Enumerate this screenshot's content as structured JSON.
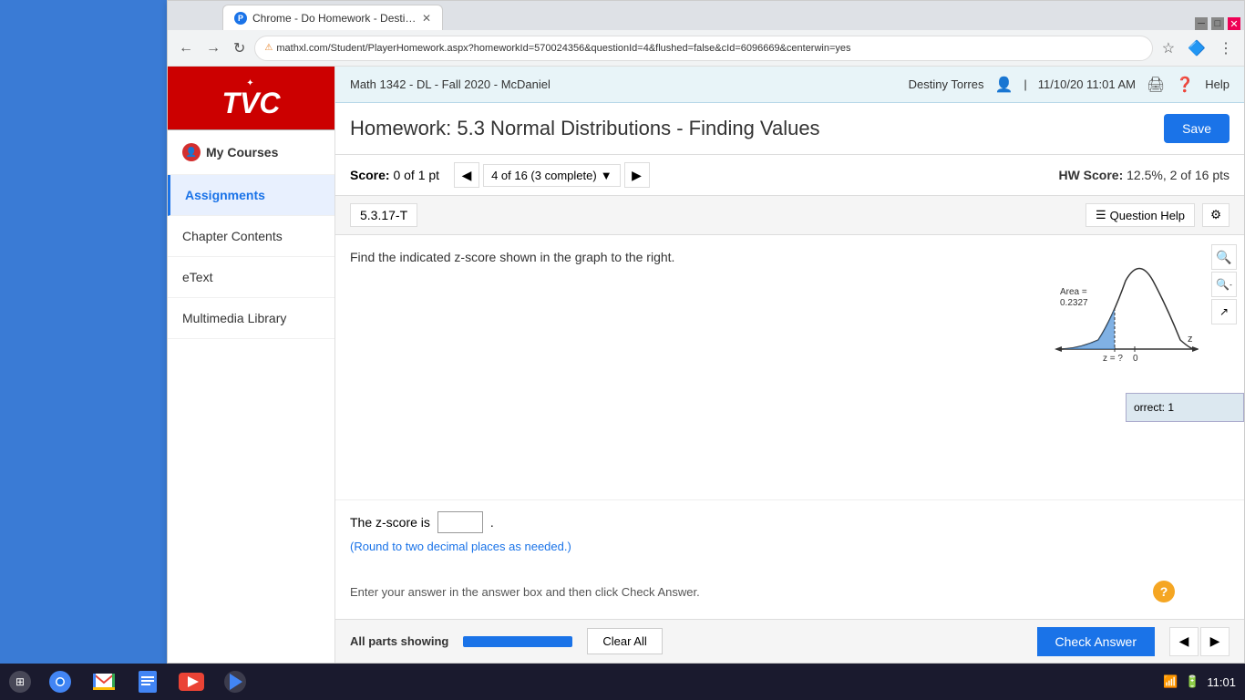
{
  "browser": {
    "title": "Chrome - Do Homework - Destiny Torres",
    "tab_label": "Chrome - Do Homework - Destiny Torres",
    "tab_favicon": "P",
    "url": "mathxl.com/Student/PlayerHomework.aspx?homeworkId=570024356&questionId=4&flushed=false&cId=6096669&centerwin=yes",
    "url_full": "mathxl.com/Student/PlayerHomework.aspx?homeworkId=570024356&questionId=4&flushed=false&cId=6096669&centerwin=yes"
  },
  "header": {
    "course": "Math 1342 - DL - Fall 2020 - McDaniel",
    "user": "Destiny Torres",
    "datetime": "11/10/20 11:01 AM",
    "print_label": "Print",
    "help_label": "Help"
  },
  "homework": {
    "title": "Homework: 5.3 Normal Distributions - Finding Values",
    "save_label": "Save",
    "score_label": "Score:",
    "score_value": "0 of 1 pt",
    "progress": "4 of 16 (3 complete)",
    "hw_score_label": "HW Score:",
    "hw_score_value": "12.5%, 2 of 16 pts"
  },
  "question": {
    "id": "5.3.17-T",
    "help_label": "Question Help",
    "question_text": "Find the indicated z-score shown in the graph to the right.",
    "answer_prefix": "The z-score is",
    "answer_hint": "(Round to two decimal places as needed.)",
    "area_label": "Area =",
    "area_value": "0.2327",
    "z_label": "z",
    "z_question": "z = ?",
    "zero_label": "0",
    "instruction": "Enter your answer in the answer box and then click Check Answer."
  },
  "bottom_bar": {
    "all_parts_label": "All parts showing",
    "clear_all_label": "Clear All",
    "check_answer_label": "Check Answer"
  },
  "sidebar": {
    "logo_text": "TVC",
    "items": [
      {
        "id": "my-courses",
        "label": "My Courses",
        "active": false,
        "icon": "person"
      },
      {
        "id": "assignments",
        "label": "Assignments",
        "active": true
      },
      {
        "id": "chapter-contents",
        "label": "Chapter Contents",
        "active": false
      },
      {
        "id": "etext",
        "label": "eText",
        "active": false
      },
      {
        "id": "multimedia-library",
        "label": "Multimedia Library",
        "active": false
      }
    ]
  },
  "taskbar": {
    "time": "11:01",
    "icons": [
      "chrome",
      "gmail",
      "docs",
      "youtube",
      "play"
    ]
  }
}
